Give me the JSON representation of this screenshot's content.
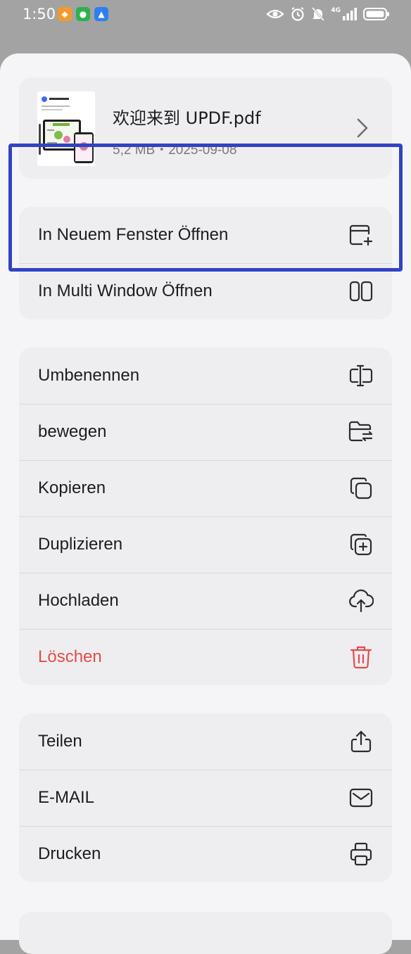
{
  "status_bar": {
    "time": "1:50",
    "network": "4G"
  },
  "file": {
    "name": "欢迎来到 UPDF.pdf",
    "meta": "5,2 MB・2025-09-08",
    "thumbnail_title": "欢迎使用 UPDF"
  },
  "window_actions": [
    {
      "label": "In Neuem Fenster Öffnen",
      "icon": "new-window-icon"
    },
    {
      "label": "In Multi Window Öffnen",
      "icon": "split-window-icon"
    }
  ],
  "file_actions": [
    {
      "label": "Umbenennen",
      "icon": "rename-icon"
    },
    {
      "label": "bewegen",
      "icon": "move-folder-icon"
    },
    {
      "label": "Kopieren",
      "icon": "copy-icon"
    },
    {
      "label": "Duplizieren",
      "icon": "duplicate-icon"
    },
    {
      "label": "Hochladen",
      "icon": "upload-cloud-icon"
    },
    {
      "label": "Löschen",
      "icon": "trash-icon",
      "color": "#e24d4b"
    }
  ],
  "share_actions": [
    {
      "label": "Teilen",
      "icon": "share-icon"
    },
    {
      "label": "E-MAIL",
      "icon": "mail-icon"
    },
    {
      "label": "Drucken",
      "icon": "printer-icon"
    }
  ],
  "colors": {
    "highlight_border": "#3243c4",
    "danger": "#e24d4b",
    "sheet_background": "#f5f5f7",
    "card_background": "#eeeef0"
  }
}
